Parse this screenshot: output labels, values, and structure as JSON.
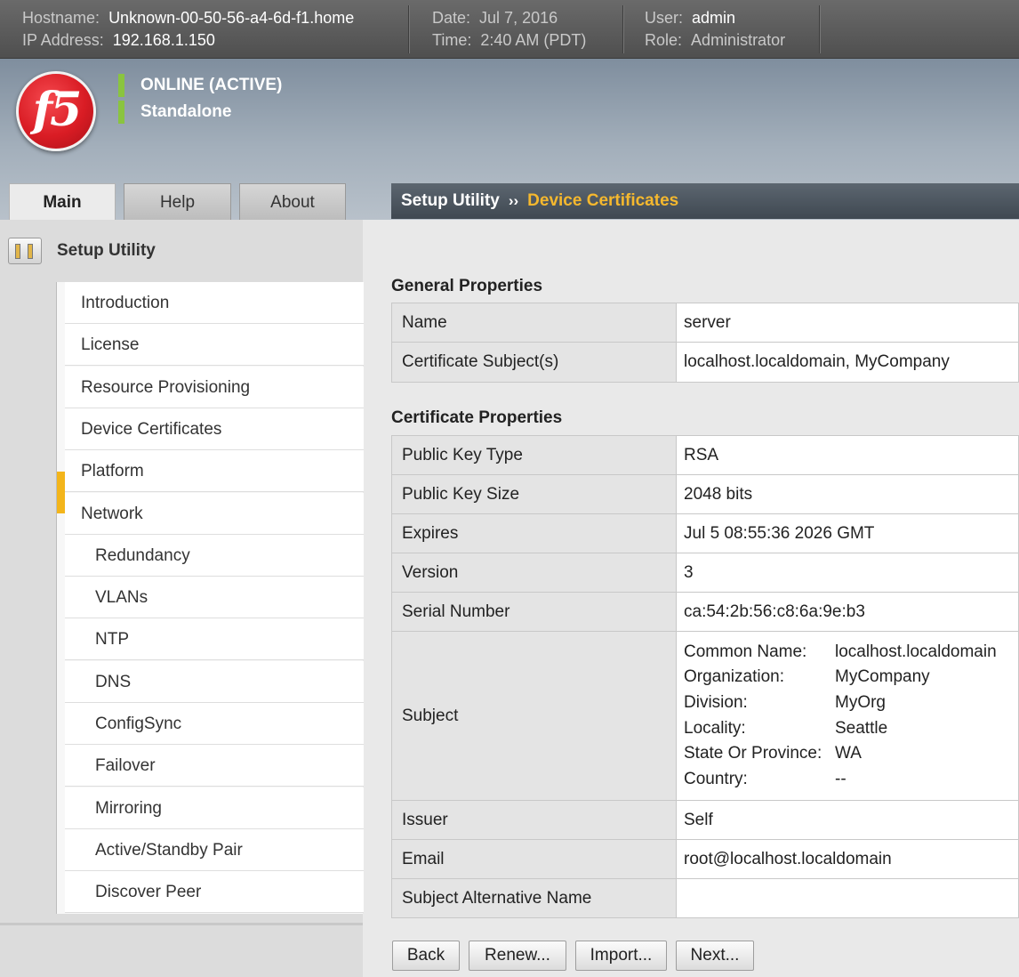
{
  "topbar": {
    "hostname_label": "Hostname:",
    "hostname": "Unknown-00-50-56-a4-6d-f1.home",
    "ip_label": "IP Address:",
    "ip": "192.168.1.150",
    "date_label": "Date:",
    "date": "Jul 7, 2016",
    "time_label": "Time:",
    "time": "2:40 AM (PDT)",
    "user_label": "User:",
    "user": "admin",
    "role_label": "Role:",
    "role": "Administrator"
  },
  "header": {
    "logo_text": "f5",
    "status": "ONLINE (ACTIVE)",
    "mode": "Standalone",
    "status_color": "#8ac43f",
    "logo_color": "#d91c24"
  },
  "tabs": [
    {
      "label": "Main",
      "active": true
    },
    {
      "label": "Help",
      "active": false
    },
    {
      "label": "About",
      "active": false
    }
  ],
  "breadcrumb": {
    "parent": "Setup Utility",
    "separator": "››",
    "current": "Device Certificates",
    "current_color": "#f5b82e"
  },
  "sidebar": {
    "title": "Setup Utility",
    "icon": "setup-utility-icon",
    "items": [
      {
        "label": "Introduction",
        "level": 0
      },
      {
        "label": "License",
        "level": 0
      },
      {
        "label": "Resource Provisioning",
        "level": 0
      },
      {
        "label": "Device Certificates",
        "level": 0,
        "selected": true
      },
      {
        "label": "Platform",
        "level": 0
      },
      {
        "label": "Network",
        "level": 0
      },
      {
        "label": "Redundancy",
        "level": 1
      },
      {
        "label": "VLANs",
        "level": 1
      },
      {
        "label": "NTP",
        "level": 1
      },
      {
        "label": "DNS",
        "level": 1
      },
      {
        "label": "ConfigSync",
        "level": 1
      },
      {
        "label": "Failover",
        "level": 1
      },
      {
        "label": "Mirroring",
        "level": 1
      },
      {
        "label": "Active/Standby Pair",
        "level": 1
      },
      {
        "label": "Discover Peer",
        "level": 1
      }
    ]
  },
  "general": {
    "title": "General Properties",
    "rows": [
      {
        "key": "Name",
        "value": "server"
      },
      {
        "key": "Certificate Subject(s)",
        "value": "localhost.localdomain, MyCompany"
      }
    ]
  },
  "certificate": {
    "title": "Certificate Properties",
    "rows": [
      {
        "key": "Public Key Type",
        "value": "RSA"
      },
      {
        "key": "Public Key Size",
        "value": "2048 bits"
      },
      {
        "key": "Expires",
        "value": "Jul 5 08:55:36 2026 GMT"
      },
      {
        "key": "Version",
        "value": "3"
      },
      {
        "key": "Serial Number",
        "value": "ca:54:2b:56:c8:6a:9e:b3"
      }
    ],
    "subject": {
      "key": "Subject",
      "fields": [
        {
          "label": "Common Name:",
          "value": "localhost.localdomain"
        },
        {
          "label": "Organization:",
          "value": "MyCompany"
        },
        {
          "label": "Division:",
          "value": "MyOrg"
        },
        {
          "label": "Locality:",
          "value": "Seattle"
        },
        {
          "label": "State Or Province:",
          "value": "WA"
        },
        {
          "label": "Country:",
          "value": "--"
        }
      ]
    },
    "rows_after": [
      {
        "key": "Issuer",
        "value": "Self"
      },
      {
        "key": "Email",
        "value": "root@localhost.localdomain"
      },
      {
        "key": "Subject Alternative Name",
        "value": ""
      }
    ]
  },
  "buttons": {
    "back": "Back",
    "renew": "Renew...",
    "import": "Import...",
    "next": "Next..."
  }
}
